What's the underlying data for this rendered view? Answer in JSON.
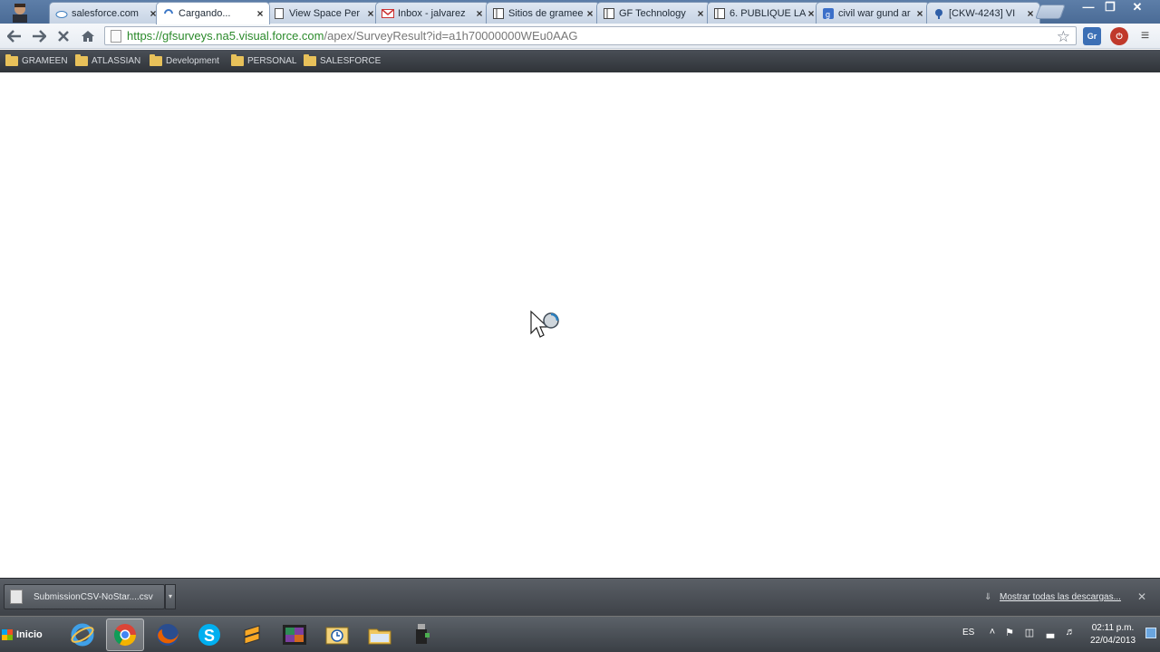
{
  "browser": {
    "tabs": [
      {
        "title": "salesforce.com",
        "icon": "cloud-icon",
        "active": false
      },
      {
        "title": "Cargando...",
        "icon": "loading-spinner-icon",
        "active": true
      },
      {
        "title": "View Space Per",
        "icon": "document-icon",
        "active": false
      },
      {
        "title": "Inbox - jalvarez",
        "icon": "gmail-icon",
        "active": false
      },
      {
        "title": "Sitios de gramee",
        "icon": "sites-icon",
        "active": false
      },
      {
        "title": "GF Technology",
        "icon": "sites-icon",
        "active": false
      },
      {
        "title": "6. PUBLIQUE LA",
        "icon": "sites-icon",
        "active": false
      },
      {
        "title": "civil war gund ar",
        "icon": "google-icon",
        "active": false
      },
      {
        "title": "[CKW-4243] VI",
        "icon": "jira-icon",
        "active": false
      }
    ],
    "url_secure": "https://gfsurveys.na5.visual.force.com",
    "url_rest": "/apex/SurveyResult?id=a1h70000000WEu0AAG",
    "bookmarks": [
      "GRAMEEN",
      "ATLASSIAN",
      "Development",
      "PERSONAL",
      "SALESFORCE"
    ],
    "tab_close_glyph": "×"
  },
  "downloads": {
    "file_name": "SubmissionCSV-NoStar....csv",
    "show_all": "Mostrar todas las descargas..."
  },
  "taskbar": {
    "start_label": "Inicio",
    "apps": [
      "internet-explorer-icon",
      "chrome-icon",
      "firefox-icon",
      "skype-icon",
      "sublime-text-icon",
      "media-player-icon",
      "outlook-icon",
      "file-explorer-icon",
      "usb-device-icon"
    ],
    "language": "ES",
    "time": "02:11 p.m.",
    "date": "22/04/2013"
  },
  "colors": {
    "url_secure": "#2b8a2b",
    "url_rest": "#777777",
    "tabstrip": "#5d7ea8",
    "bookmarks_bar": "#3a3e44"
  }
}
